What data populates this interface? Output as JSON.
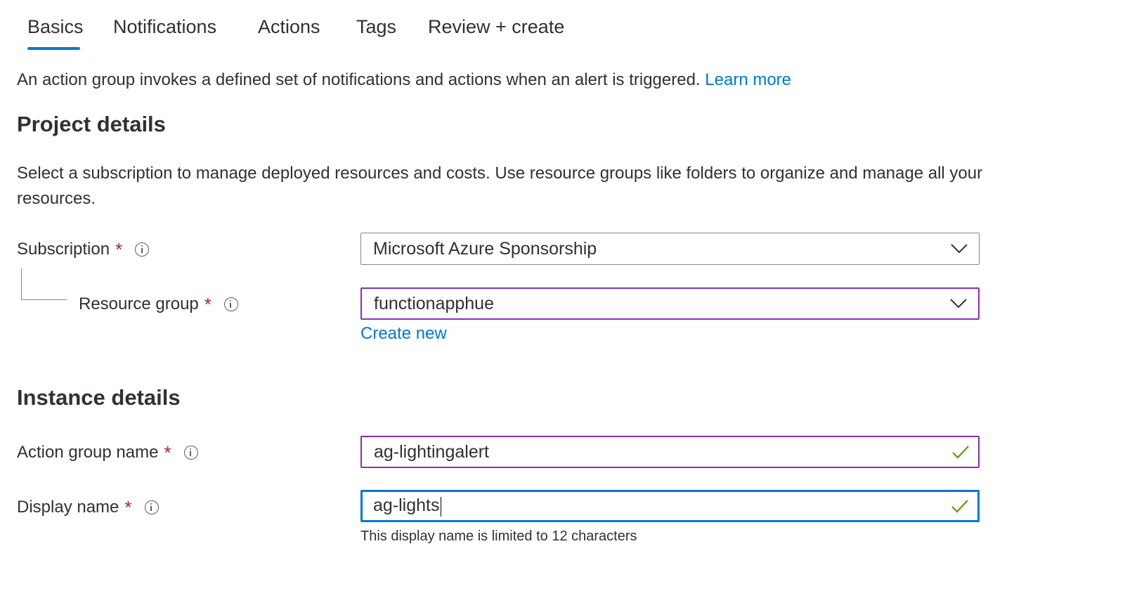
{
  "tabs": [
    {
      "label": "Basics",
      "active": true
    },
    {
      "label": "Notifications",
      "active": false
    },
    {
      "label": "Actions",
      "active": false
    },
    {
      "label": "Tags",
      "active": false
    },
    {
      "label": "Review + create",
      "active": false
    }
  ],
  "intro": {
    "text": "An action group invokes a defined set of notifications and actions when an alert is triggered.",
    "link": "Learn more"
  },
  "project_details": {
    "title": "Project details",
    "description": "Select a subscription to manage deployed resources and costs. Use resource groups like folders to organize and manage all your resources.",
    "subscription": {
      "label": "Subscription",
      "required_mark": "*",
      "value": "Microsoft Azure Sponsorship"
    },
    "resource_group": {
      "label": "Resource group",
      "required_mark": "*",
      "value": "functionapphue",
      "create_new": "Create new"
    }
  },
  "instance_details": {
    "title": "Instance details",
    "action_group_name": {
      "label": "Action group name",
      "required_mark": "*",
      "value": "ag-lightingalert"
    },
    "display_name": {
      "label": "Display name",
      "required_mark": "*",
      "value": "ag-lights",
      "hint": "This display name is limited to 12 characters"
    }
  },
  "colors": {
    "accent": "#0078d4",
    "required": "#a4262c",
    "validation_border": "#8b2fb4",
    "success_check": "#57a300"
  }
}
